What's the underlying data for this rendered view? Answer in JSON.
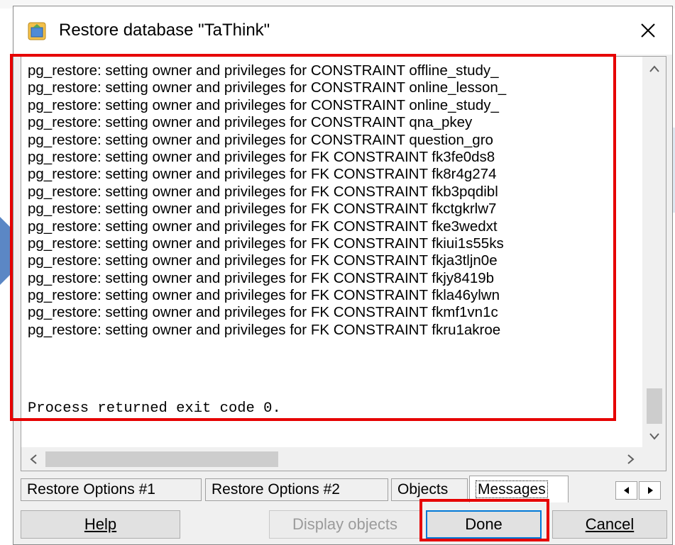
{
  "dialog": {
    "title": "Restore database \"TaThink\"",
    "close_glyph": "✕"
  },
  "log": {
    "lines": [
      "pg_restore: setting owner and privileges for CONSTRAINT offline_study_",
      "pg_restore: setting owner and privileges for CONSTRAINT online_lesson_",
      "pg_restore: setting owner and privileges for CONSTRAINT online_study_",
      "pg_restore: setting owner and privileges for CONSTRAINT qna_pkey",
      "pg_restore: setting owner and privileges for CONSTRAINT question_gro",
      "pg_restore: setting owner and privileges for FK CONSTRAINT fk3fe0ds8",
      "pg_restore: setting owner and privileges for FK CONSTRAINT fk8r4g274",
      "pg_restore: setting owner and privileges for FK CONSTRAINT fkb3pqdibl",
      "pg_restore: setting owner and privileges for FK CONSTRAINT fkctgkrlw7",
      "pg_restore: setting owner and privileges for FK CONSTRAINT fke3wedxt",
      "pg_restore: setting owner and privileges for FK CONSTRAINT fkiui1s55ks",
      "pg_restore: setting owner and privileges for FK CONSTRAINT fkja3tljn0e",
      "pg_restore: setting owner and privileges for FK CONSTRAINT fkjy8419b",
      "pg_restore: setting owner and privileges for FK CONSTRAINT fkla46ylwn",
      "pg_restore: setting owner and privileges for FK CONSTRAINT fkmf1vn1c",
      "pg_restore: setting owner and privileges for FK CONSTRAINT fkru1akroe"
    ],
    "result": "Process returned exit code 0."
  },
  "tabs": {
    "items": [
      "Restore Options #1",
      "Restore Options #2",
      "Objects",
      "Messages"
    ],
    "active": "Messages",
    "nav_left": "◂",
    "nav_right": "▸"
  },
  "buttons": {
    "help": "Help",
    "display_objects": "Display objects",
    "done": "Done",
    "cancel": "Cancel"
  },
  "colors": {
    "highlight": "#e60000",
    "default_button_border": "#0078d7",
    "arrow": "#5b87c5"
  }
}
